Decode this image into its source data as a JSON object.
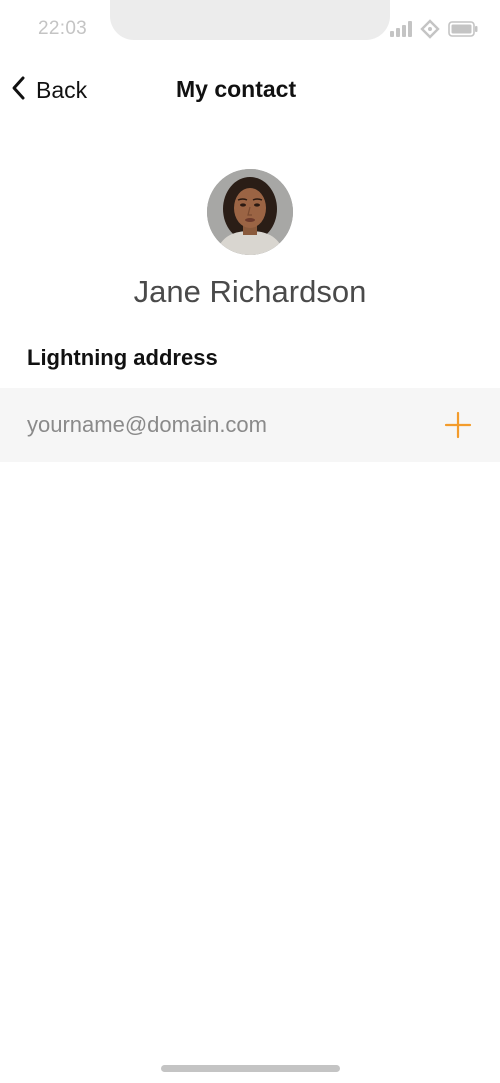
{
  "status_bar": {
    "time": "22:03",
    "icons": [
      "signal-icon",
      "wifi-icon",
      "battery-icon"
    ]
  },
  "nav": {
    "back_label": "Back",
    "title": "My contact"
  },
  "contact": {
    "name": "Jane Richardson",
    "avatar": "avatar-photo"
  },
  "lightning": {
    "heading": "Lightning address",
    "input_value": "",
    "input_placeholder": "yourname@domain.com",
    "add_icon": "plus-icon"
  },
  "colors": {
    "accent": "#f39c2c",
    "row_background": "#f6f6f6",
    "muted_text": "#8a8a8a",
    "status_gray": "#c4c4c4"
  }
}
